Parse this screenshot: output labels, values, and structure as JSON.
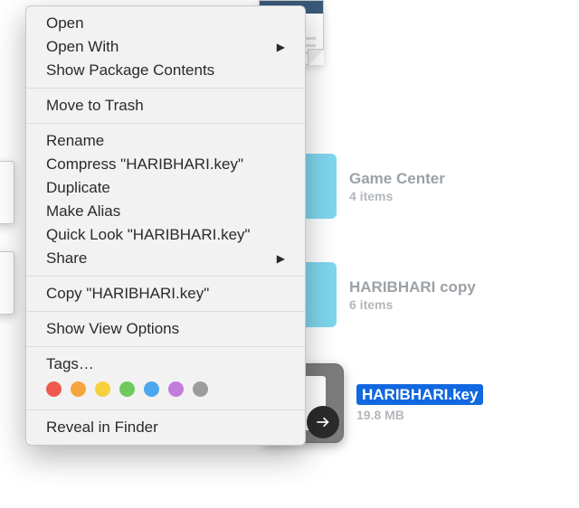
{
  "menu": {
    "open": "Open",
    "open_with": "Open With",
    "show_package": "Show Package Contents",
    "move_trash": "Move to Trash",
    "rename": "Rename",
    "compress": "Compress \"HARIBHARI.key\"",
    "duplicate": "Duplicate",
    "make_alias": "Make Alias",
    "quick_look": "Quick Look \"HARIBHARI.key\"",
    "share": "Share",
    "copy": "Copy \"HARIBHARI.key\"",
    "view_options": "Show View Options",
    "tags": "Tags…",
    "reveal": "Reveal in Finder"
  },
  "tag_colors": [
    "#ef5b4f",
    "#f6a43c",
    "#f6d03d",
    "#6eca5c",
    "#4da7ee",
    "#c37cdd",
    "#9c9c9c"
  ],
  "items": {
    "gamecenter": {
      "label": "Game Center",
      "sub": "4 items"
    },
    "haribhari_copy": {
      "label": "HARIBHARI copy",
      "sub": "6 items"
    },
    "haribhari_key": {
      "label": "HARIBHARI.key",
      "sub": "19.8 MB"
    }
  }
}
